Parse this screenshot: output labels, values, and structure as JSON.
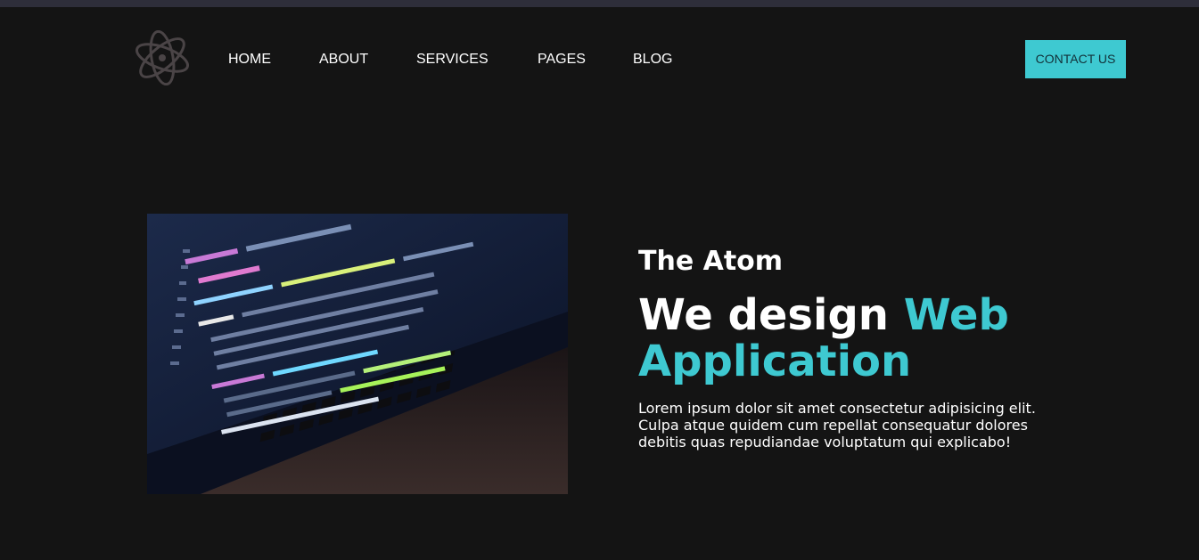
{
  "header": {
    "logo_icon": "atom-icon",
    "nav": [
      {
        "label": "HOME"
      },
      {
        "label": "ABOUT"
      },
      {
        "label": "SERVICES"
      },
      {
        "label": "PAGES"
      },
      {
        "label": "BLOG"
      }
    ],
    "contact_label": "CONTACT US"
  },
  "hero": {
    "eyebrow": "The Atom",
    "headline_plain": "We design ",
    "headline_accent": "Web Application",
    "description": "Lorem ipsum dolor sit amet consectetur adipisicing elit. Culpa atque quidem cum repellat consequatur dolores debitis quas repudiandae voluptatum qui explicabo!",
    "image_icon": "laptop-code-photo"
  },
  "colors": {
    "background": "#141414",
    "accent": "#3ec9d1",
    "text": "#ffffff"
  }
}
